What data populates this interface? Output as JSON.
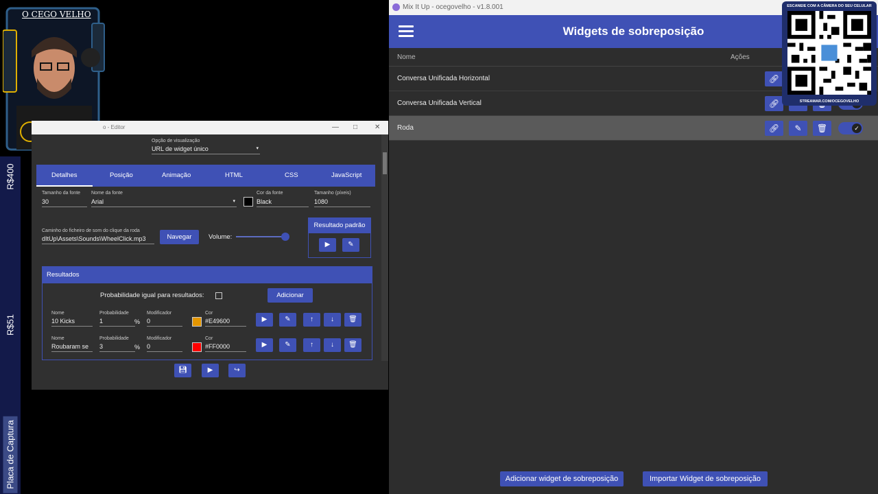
{
  "overlay": {
    "streamer_name": "O CEGO VELHO",
    "side_labels": [
      "R$400",
      "R$51",
      "Placa de Captura"
    ],
    "qr_caption": "ESCANEIE COM A CÂMERA DO SEU CELULAR",
    "qr_footer": "STREAMAR.COM/OCEGOVELHO"
  },
  "main": {
    "window_title": "Mix It Up - ocegovelho - v1.8.001",
    "header_title": "Widgets de sobreposição",
    "columns": {
      "name": "Nome",
      "actions": "Ações"
    },
    "rows": [
      {
        "name": "Conversa Unificada Horizontal"
      },
      {
        "name": "Conversa Unificada Vertical"
      },
      {
        "name": "Roda"
      }
    ],
    "add_button": "Adicionar widget de sobreposição",
    "import_button": "Importar Widget de sobreposição"
  },
  "editor": {
    "window_title": "o - Editor",
    "view_option": {
      "label": "Opção de visualização",
      "value": "URL de widget único"
    },
    "tabs": [
      "Detalhes",
      "Posição",
      "Animação",
      "HTML",
      "CSS",
      "JavaScript"
    ],
    "font_size": {
      "label": "Tamanho da fonte",
      "value": "30"
    },
    "font_name": {
      "label": "Nome da fonte",
      "value": "Arial"
    },
    "font_color": {
      "label": "Cor da fonte",
      "value": "Black",
      "swatch": "#000000"
    },
    "size_px": {
      "label": "Tamanho (píxeis)",
      "value": "1080"
    },
    "sound_path": {
      "label": "Caminho do ficheiro de som do clique da roda",
      "value": "dItUp\\Assets\\Sounds\\WheelClick.mp3"
    },
    "browse_button": "Navegar",
    "volume_label": "Volume:",
    "volume_level": 1.0,
    "default_result": "Resultado padrão",
    "results": {
      "title": "Resultados",
      "equal_prob_label": "Probabilidade igual para resultados:",
      "add_button": "Adicionar",
      "labels": {
        "name": "Nome",
        "prob": "Probabilidade",
        "mod": "Modificador",
        "color": "Cor"
      },
      "pct": "%",
      "items": [
        {
          "name": "10 Kicks",
          "prob": "1",
          "mod": "0",
          "color": "#E49600"
        },
        {
          "name": "Roubaram se",
          "prob": "3",
          "mod": "0",
          "color": "#FF0000"
        }
      ]
    }
  },
  "colors": {
    "accent": "#3f51b5",
    "bg_dark": "#2d2d2d"
  },
  "icons": [
    "menu-icon",
    "link-icon",
    "edit-icon",
    "delete-icon",
    "check-icon",
    "play-icon",
    "arrow-up-icon",
    "arrow-down-icon",
    "save-icon",
    "export-icon"
  ]
}
